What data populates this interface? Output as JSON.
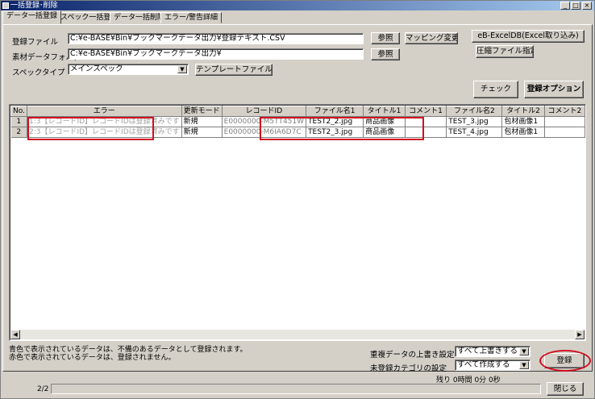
{
  "window": {
    "title": "一括登録･削除",
    "controls": [
      "_",
      "□",
      "×"
    ]
  },
  "tabs": [
    {
      "label": "データ一括登録"
    },
    {
      "label": "スペック一括登録"
    },
    {
      "label": "データ一括削除"
    },
    {
      "label": "エラー/警告詳細"
    }
  ],
  "form": {
    "file_label": "登録ファイル",
    "file_value": "C:¥e-BASE¥Bin¥ブックマークデータ出力¥登録テキスト.CSV",
    "folder_label": "素材データフォルダ",
    "folder_value": "C:¥e-BASE¥Bin¥ブックマークデータ出力¥",
    "spec_label": "スペックタイプ",
    "spec_value": "メインスペック",
    "browse_label": "参照",
    "browse2_label": "参照",
    "mapping_label": "マッピング変更",
    "template_label": "テンプレートファイル作成",
    "excel_label": "eB-ExcelDB(Excel取り込み)",
    "compressed_label": "圧縮ファイル指定",
    "check_label": "チェック",
    "options_label": "登録オプション"
  },
  "grid": {
    "columns": [
      "No.",
      "エラー",
      "更新モード",
      "レコードID",
      "ファイル名1",
      "タイトル1",
      "コメント1",
      "ファイル名2",
      "タイトル2",
      "コメント2"
    ],
    "rows": [
      [
        "1",
        "1:3【レコードID】レコードIDは登録済みです",
        "新規",
        "E0000000-M5TT451W",
        "TEST2_2.jpg",
        "商品画像",
        "",
        "TEST_3.jpg",
        "包材画像1",
        ""
      ],
      [
        "2",
        "2:3【レコードID】レコードIDは登録済みです",
        "新規",
        "E0000000-M6IA6D7C",
        "TEST2_3.jpg",
        "商品画像",
        "",
        "TEST_4.jpg",
        "包材画像1",
        ""
      ]
    ]
  },
  "notes": {
    "blue_note": "青色で表示されているデータは、不備のあるデータとして登録されます。",
    "red_note": "赤色で表示されているデータは、登録されません。"
  },
  "settings": {
    "overwrite_label": "重複データの上書き設定",
    "overwrite_value": "すべて上書きする",
    "category_label": "未登録カテゴリの設定",
    "category_value": "すべて作成する",
    "register_label": "登録"
  },
  "status": {
    "remaining": "残り 0時間 0分 0秒",
    "page": "2/2",
    "close_label": "閉じる"
  },
  "colors": {
    "highlight": "#d01020",
    "titlebar": "#0a246a"
  }
}
